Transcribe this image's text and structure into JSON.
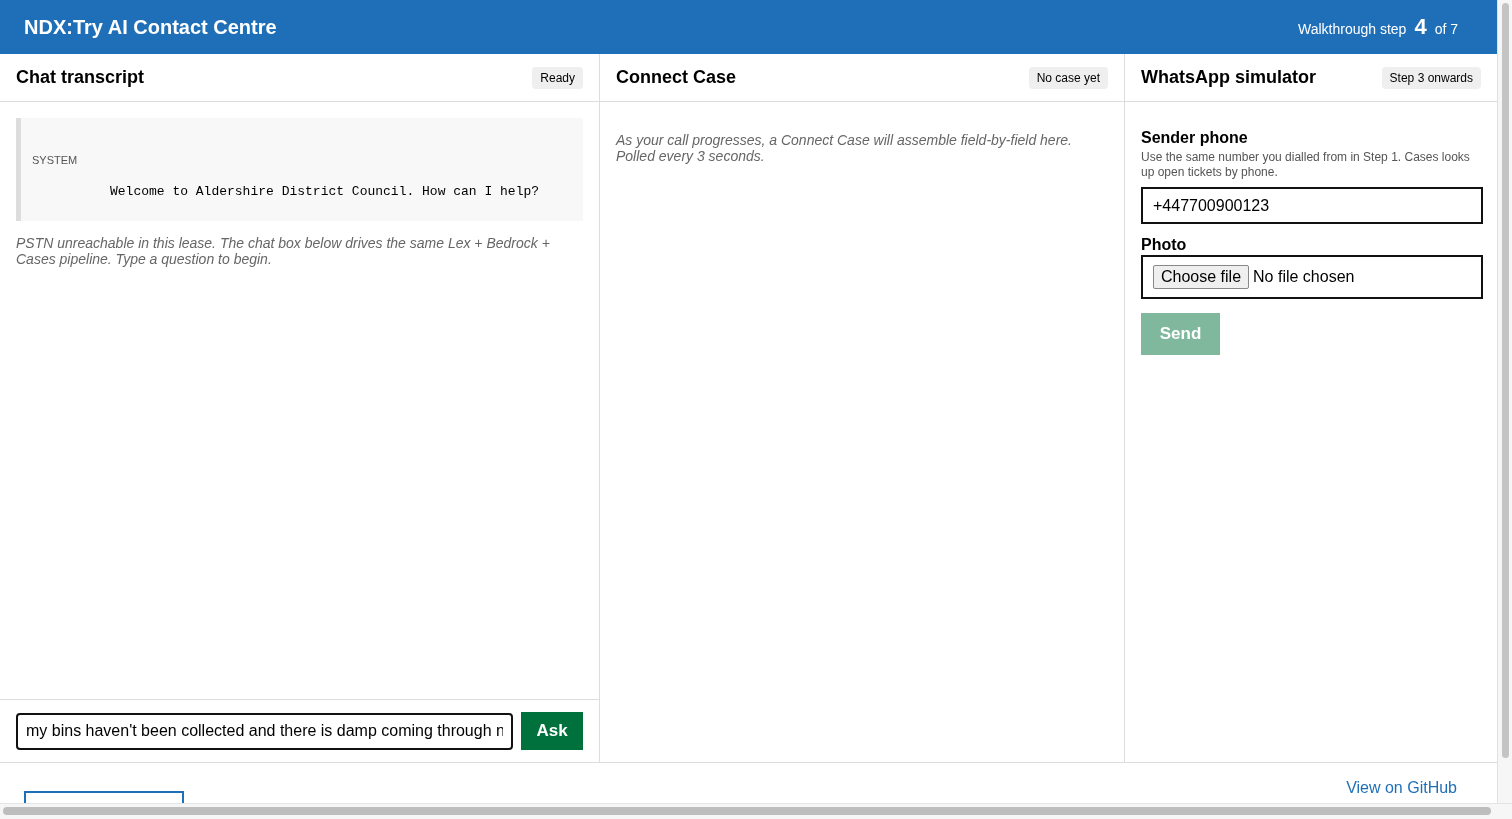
{
  "header": {
    "title": "NDX:Try AI Contact Centre",
    "step_label": "Walkthrough step",
    "step_number": "4",
    "step_total": "of 7"
  },
  "chat": {
    "title": "Chat transcript",
    "status": "Ready",
    "messages": [
      {
        "role": "SYSTEM",
        "text": "Welcome to Aldershire District Council. How can I help?"
      }
    ],
    "note": "PSTN unreachable in this lease. The chat box below drives the same Lex + Bedrock + Cases pipeline. Type a question to begin.",
    "input_value": "my bins haven't been collected and there is damp coming through n",
    "ask_label": "Ask"
  },
  "case": {
    "title": "Connect Case",
    "status": "No case yet",
    "note": "As your call progresses, a Connect Case will assemble field-by-field here. Polled every 3 seconds."
  },
  "whatsapp": {
    "title": "WhatsApp simulator",
    "status": "Step 3 onwards",
    "phone_label": "Sender phone",
    "phone_help": "Use the same number you dialled from in Step 1. Cases looks up open tickets by phone.",
    "phone_value": "+447700900123",
    "photo_label": "Photo",
    "choose_file": "Choose file",
    "file_status": "No file chosen",
    "send_label": "Send",
    "send_disabled": true
  },
  "footer": {
    "link": "View on GitHub"
  }
}
